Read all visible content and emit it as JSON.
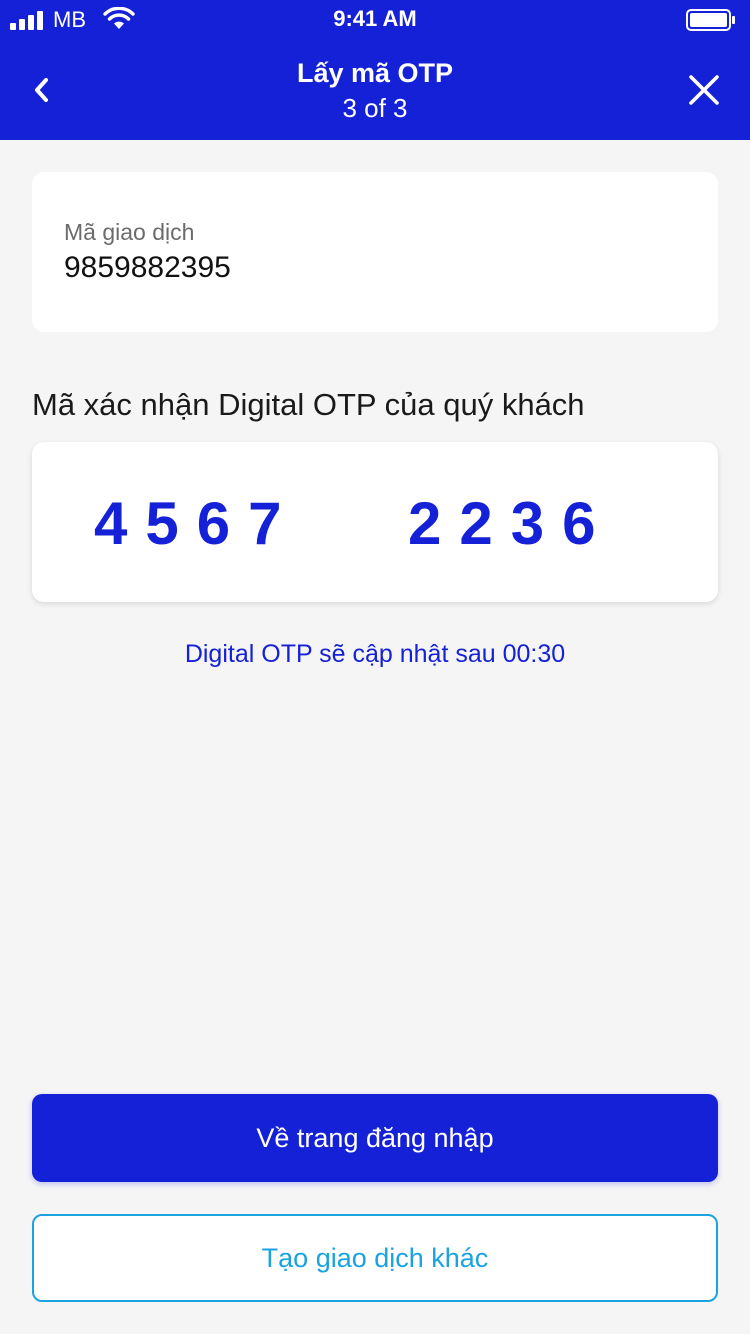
{
  "status_bar": {
    "carrier": "MB",
    "time": "9:41 AM",
    "signal_bars": 4,
    "battery_level": 1.0
  },
  "header": {
    "title": "Lấy mã OTP",
    "subtitle": "3 of 3",
    "back_icon": "chevron-left-icon",
    "close_icon": "close-icon"
  },
  "transaction": {
    "label": "Mã giao dịch",
    "value": "9859882395"
  },
  "otp": {
    "heading": "Mã xác nhận Digital OTP của quý khách",
    "group_1": "4567",
    "group_2": "2236",
    "refresh_note": "Digital OTP sẽ cập nhật sau 00:30"
  },
  "actions": {
    "primary_label": "Về trang đăng nhập",
    "secondary_label": "Tạo giao dịch khác"
  },
  "colors": {
    "brand": "#1521d6",
    "secondary_accent": "#1aa3e0",
    "background": "#f5f5f5"
  }
}
